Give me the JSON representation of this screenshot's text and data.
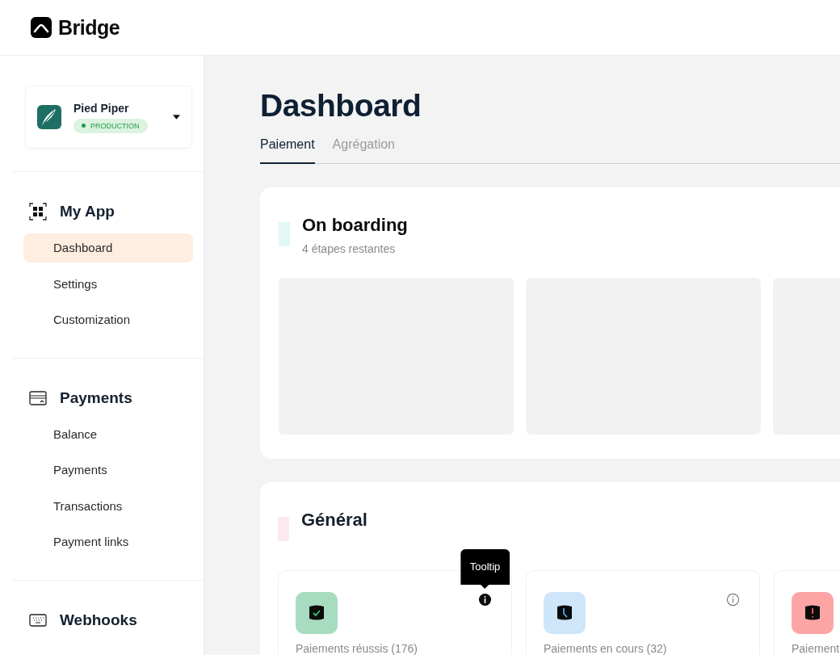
{
  "header": {
    "brand": "Bridge"
  },
  "sidebar": {
    "org": {
      "name": "Pied Piper",
      "env": "PRODUCTION"
    },
    "sections": [
      {
        "title": "My App",
        "items": [
          {
            "label": "Dashboard",
            "selected": true
          },
          {
            "label": "Settings",
            "selected": false
          },
          {
            "label": "Customization",
            "selected": false
          }
        ]
      },
      {
        "title": "Payments",
        "items": [
          {
            "label": "Balance",
            "selected": false
          },
          {
            "label": "Payments",
            "selected": false
          },
          {
            "label": "Transactions",
            "selected": false
          },
          {
            "label": "Payment links",
            "selected": false
          }
        ]
      },
      {
        "title": "Webhooks"
      }
    ]
  },
  "main": {
    "title": "Dashboard",
    "tabs": [
      {
        "label": "Paiement",
        "selected": true
      },
      {
        "label": "Agrégation",
        "selected": false
      }
    ],
    "onboarding": {
      "title": "On boarding",
      "subtitle": "4 étapes restantes",
      "color": "#e3f7f4",
      "tiles": [
        {
          "kind": "placeholder"
        },
        {
          "kind": "placeholder"
        },
        {
          "kind": "placeholder"
        }
      ]
    },
    "general": {
      "title": "Général",
      "color": "#fdeaf1",
      "tooltip": "Tooltip",
      "stats": [
        {
          "label": "Paiements réussis (176)",
          "kind": "success",
          "color": "#a8dcc0",
          "info_hovered": true
        },
        {
          "label": "Paiements en cours (32)",
          "kind": "pending",
          "color": "#cfe6fa",
          "info_hovered": false
        },
        {
          "label": "Paiement",
          "kind": "failed",
          "color": "#fca5a5"
        }
      ]
    }
  }
}
